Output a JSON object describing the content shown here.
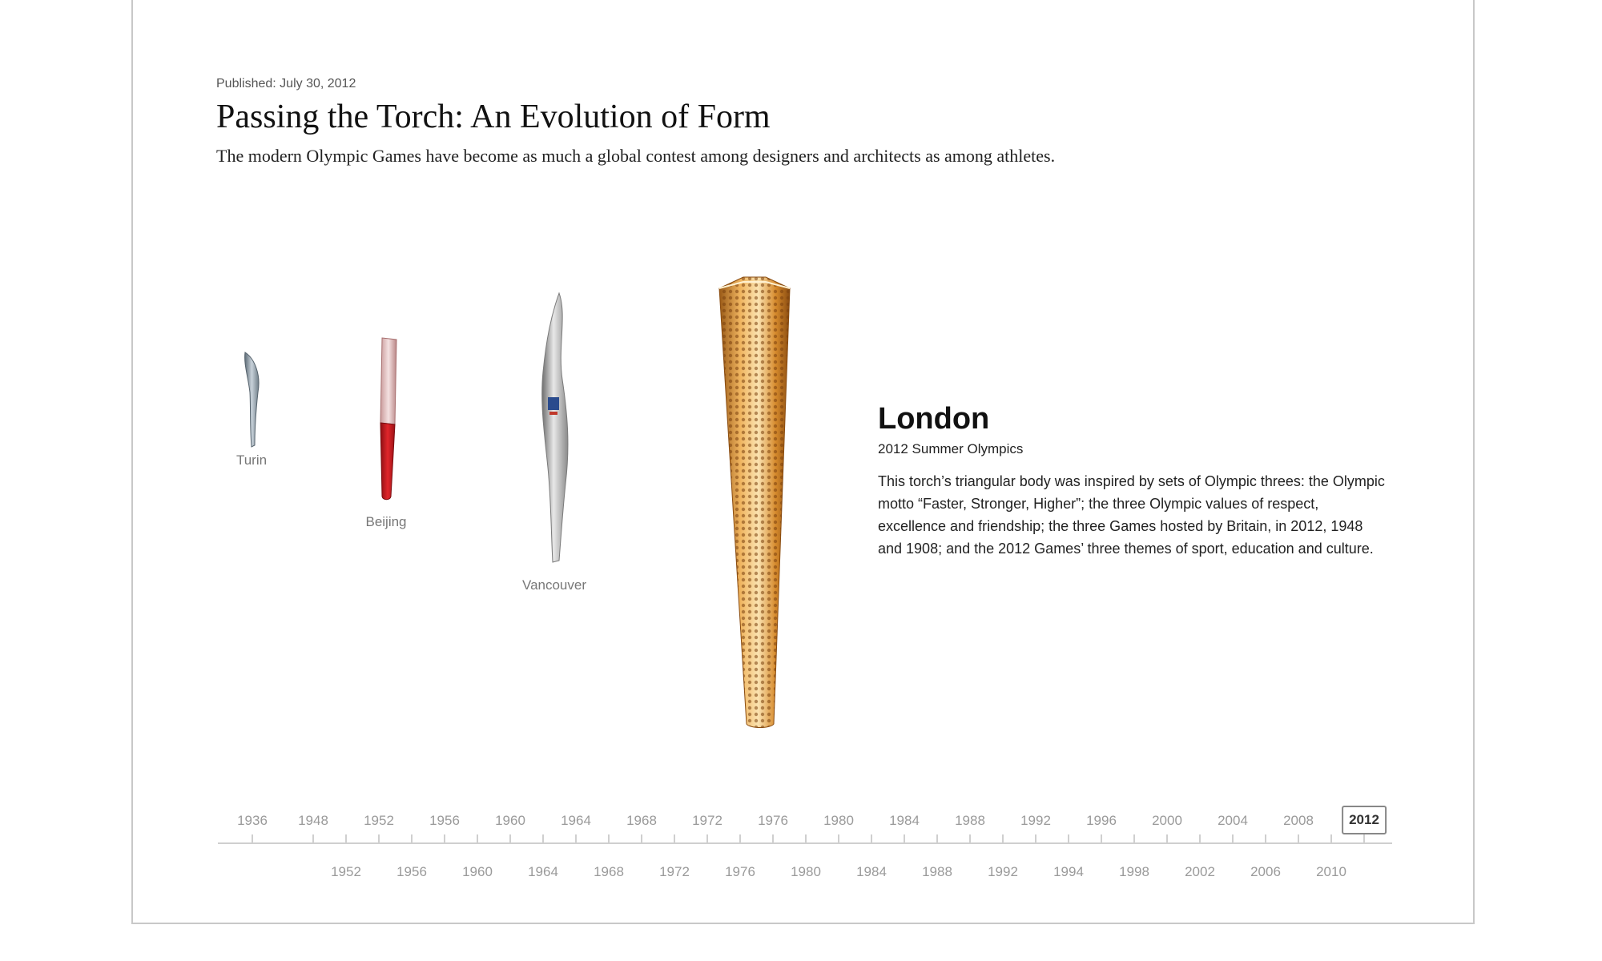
{
  "article": {
    "published": "Published: July 30, 2012",
    "title": "Passing the Torch: An Evolution of Form",
    "subtitle": "The modern Olympic Games have become as much a global contest among designers and architects as among athletes."
  },
  "torches": [
    {
      "label": "Turin",
      "color": "#7f8c96"
    },
    {
      "label": "Beijing",
      "color": "#c8191e"
    },
    {
      "label": "Vancouver",
      "color": "#b9b9b9"
    },
    {
      "label": "",
      "color": "#d99a3a"
    }
  ],
  "selected": {
    "city": "London",
    "games": "2012 Summer Olympics",
    "description": "This torch’s triangular body was inspired by sets of Olympic threes: the Olympic motto “Faster, Stronger, Higher”; the three Olympic values of respect, excellence and friendship; the three Games hosted by Britain, in 2012, 1948 and 1908; and the 2012 Games’ three themes of sport, education and culture."
  },
  "timeline": {
    "top_years": [
      "1936",
      "1948",
      "1952",
      "1956",
      "1960",
      "1964",
      "1968",
      "1972",
      "1976",
      "1980",
      "1984",
      "1988",
      "1992",
      "1996",
      "2000",
      "2004",
      "2008",
      "2012"
    ],
    "bottom_years": [
      "1952",
      "1956",
      "1960",
      "1964",
      "1968",
      "1972",
      "1976",
      "1980",
      "1984",
      "1988",
      "1992",
      "1994",
      "1998",
      "2002",
      "2006",
      "2010"
    ],
    "active_year": "2012"
  }
}
